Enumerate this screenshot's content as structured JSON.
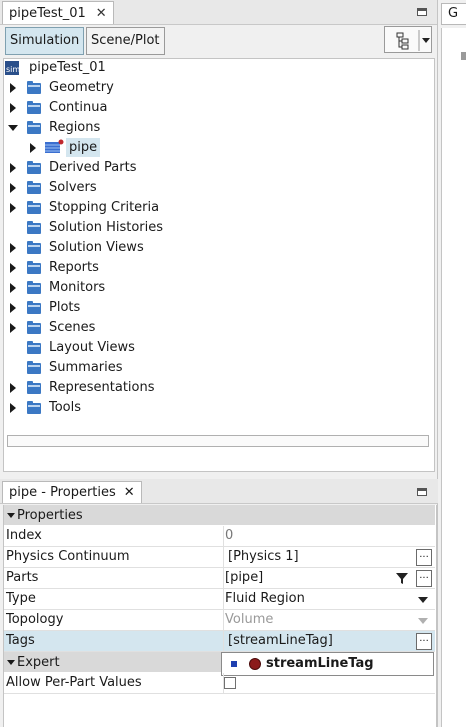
{
  "top_tab": {
    "label": "pipeTest_01",
    "close": "✕"
  },
  "right_tab": {
    "label": "G"
  },
  "toolbar": {
    "simulation": "Simulation",
    "scene_plot": "Scene/Plot"
  },
  "tree": {
    "root": "pipeTest_01",
    "root_icon": "sim",
    "items": [
      {
        "label": "Geometry"
      },
      {
        "label": "Continua"
      },
      {
        "label": "Regions"
      },
      {
        "label": "pipe"
      },
      {
        "label": "Derived Parts"
      },
      {
        "label": "Solvers"
      },
      {
        "label": "Stopping Criteria"
      },
      {
        "label": "Solution Histories"
      },
      {
        "label": "Solution Views"
      },
      {
        "label": "Reports"
      },
      {
        "label": "Monitors"
      },
      {
        "label": "Plots"
      },
      {
        "label": "Scenes"
      },
      {
        "label": "Layout Views"
      },
      {
        "label": "Summaries"
      },
      {
        "label": "Representations"
      },
      {
        "label": "Tools"
      }
    ]
  },
  "properties": {
    "tab_label": "pipe - Properties",
    "close": "✕",
    "section_properties": "Properties",
    "section_expert": "Expert",
    "rows": {
      "index": {
        "name": "Index",
        "value": "0"
      },
      "physics": {
        "name": "Physics Continuum",
        "value": "[Physics 1]"
      },
      "parts": {
        "name": "Parts",
        "value": "[pipe]"
      },
      "type": {
        "name": "Type",
        "value": "Fluid Region"
      },
      "topology": {
        "name": "Topology",
        "value": "Volume"
      },
      "tags": {
        "name": "Tags",
        "value": "[streamLineTag]"
      },
      "allow": {
        "name": "Allow Per-Part Values"
      }
    },
    "tag_popup": "streamLineTag",
    "dots": "..."
  },
  "colors": {
    "folder": "#3b78c4",
    "selected": "#d4e6ef",
    "tag_red": "#8b1a1a"
  }
}
